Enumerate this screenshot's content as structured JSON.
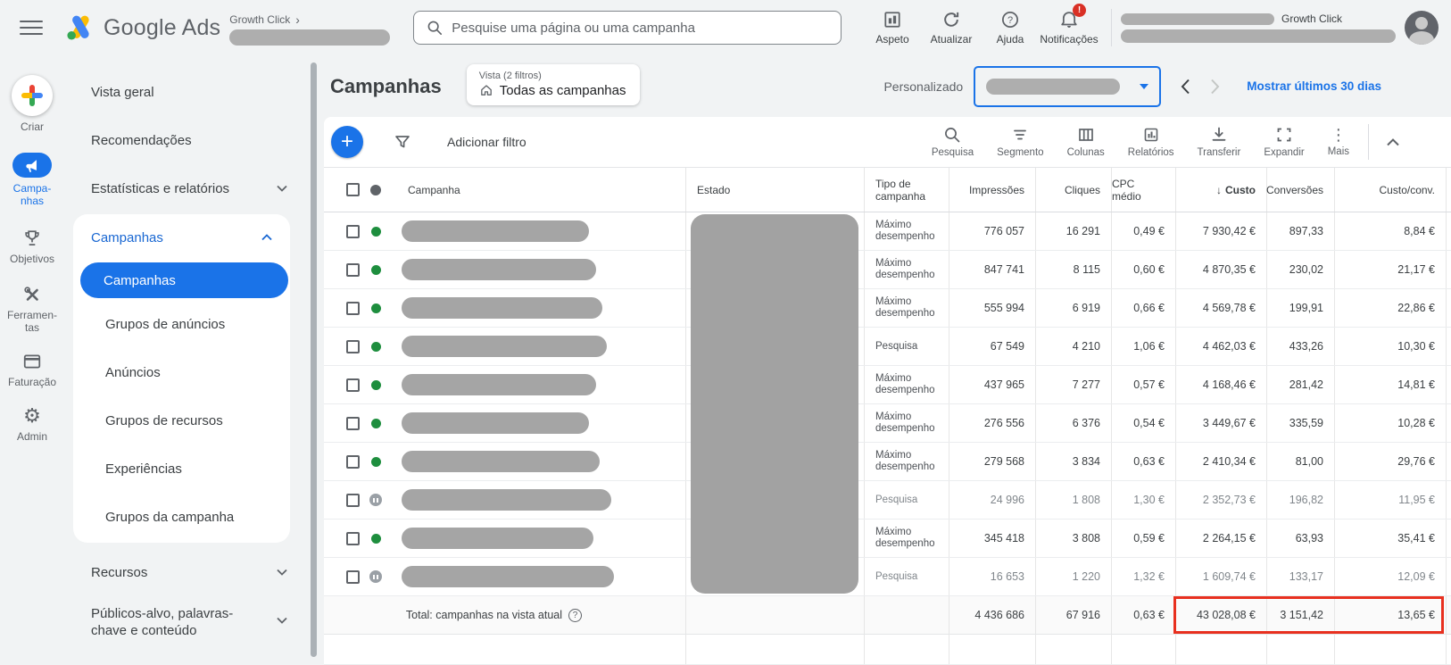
{
  "topbar": {
    "breadcrumb": {
      "account": "Growth Click",
      "chevron": "›"
    },
    "search": {
      "placeholder": "Pesquise uma página ou uma campanha"
    },
    "actions": [
      {
        "label": "Aspeto",
        "icon": "appearance-chart-icon"
      },
      {
        "label": "Atualizar",
        "icon": "refresh-icon"
      },
      {
        "label": "Ajuda",
        "icon": "help-icon"
      },
      {
        "label": "Notificações",
        "icon": "bell-icon",
        "badge": "!"
      }
    ],
    "account": {
      "name": "Growth Click"
    }
  },
  "rail": [
    {
      "label": "Criar",
      "icon": "plus-icon"
    },
    {
      "label": "Campa-nhas",
      "icon": "megaphone-icon"
    },
    {
      "label": "Objetivos",
      "icon": "trophy-icon"
    },
    {
      "label": "Ferramen-tas",
      "icon": "tools-icon"
    },
    {
      "label": "Faturação",
      "icon": "billing-card-icon"
    },
    {
      "label": "Admin",
      "icon": "gear-icon"
    }
  ],
  "sidenav": {
    "top_items": [
      {
        "label": "Vista geral"
      },
      {
        "label": "Recomendações"
      },
      {
        "label": "Estatísticas e relatórios",
        "chevron": "down"
      }
    ],
    "campaigns_group": {
      "label": "Campanhas",
      "chevron": "up",
      "items": [
        {
          "label": "Campanhas",
          "selected": true
        },
        {
          "label": "Grupos de anúncios"
        },
        {
          "label": "Anúncios"
        },
        {
          "label": "Grupos de recursos"
        },
        {
          "label": "Experiências"
        },
        {
          "label": "Grupos da campanha"
        }
      ]
    },
    "bottom_items": [
      {
        "label": "Recursos",
        "chevron": "down"
      },
      {
        "label": "Públicos-alvo, palavras-chave e conteúdo",
        "chevron": "down"
      }
    ]
  },
  "page_header": {
    "title": "Campanhas",
    "view_chip": {
      "caption": "Vista (2 filtros)",
      "value": "Todas as campanhas"
    },
    "date_range": {
      "label": "Personalizado",
      "link": "Mostrar últimos 30 dias"
    }
  },
  "toolbar": {
    "add_filter_label": "Adicionar filtro",
    "buttons": [
      {
        "label": "Pesquisa",
        "icon": "search-icon"
      },
      {
        "label": "Segmento",
        "icon": "segment-icon"
      },
      {
        "label": "Colunas",
        "icon": "columns-icon"
      },
      {
        "label": "Relatórios",
        "icon": "reports-icon"
      },
      {
        "label": "Transferir",
        "icon": "download-icon"
      },
      {
        "label": "Expandir",
        "icon": "expand-icon"
      },
      {
        "label": "Mais",
        "icon": "more-icon"
      }
    ]
  },
  "table": {
    "headers": {
      "campaign": "Campanha",
      "estado": "Estado",
      "tipo": "Tipo de campanha",
      "impressoes": "Impressões",
      "cliques": "Cliques",
      "cpc": "CPC médio",
      "custo_sort": "↓",
      "custo": "Custo",
      "conversoes": "Conversões",
      "custo_conv": "Custo/conv."
    },
    "rows": [
      {
        "status": "enabled",
        "tipo": "Máximo desempenho",
        "impressoes": "776 057",
        "cliques": "16 291",
        "cpc": "0,49 €",
        "custo": "7 930,42 €",
        "conversoes": "897,33",
        "custo_conv": "8,84 €"
      },
      {
        "status": "enabled",
        "tipo": "Máximo desempenho",
        "impressoes": "847 741",
        "cliques": "8 115",
        "cpc": "0,60 €",
        "custo": "4 870,35 €",
        "conversoes": "230,02",
        "custo_conv": "21,17 €"
      },
      {
        "status": "enabled",
        "tipo": "Máximo desempenho",
        "impressoes": "555 994",
        "cliques": "6 919",
        "cpc": "0,66 €",
        "custo": "4 569,78 €",
        "conversoes": "199,91",
        "custo_conv": "22,86 €"
      },
      {
        "status": "enabled",
        "tipo": "Pesquisa",
        "impressoes": "67 549",
        "cliques": "4 210",
        "cpc": "1,06 €",
        "custo": "4 462,03 €",
        "conversoes": "433,26",
        "custo_conv": "10,30 €"
      },
      {
        "status": "enabled",
        "tipo": "Máximo desempenho",
        "impressoes": "437 965",
        "cliques": "7 277",
        "cpc": "0,57 €",
        "custo": "4 168,46 €",
        "conversoes": "281,42",
        "custo_conv": "14,81 €"
      },
      {
        "status": "enabled",
        "tipo": "Máximo desempenho",
        "impressoes": "276 556",
        "cliques": "6 376",
        "cpc": "0,54 €",
        "custo": "3 449,67 €",
        "conversoes": "335,59",
        "custo_conv": "10,28 €"
      },
      {
        "status": "enabled",
        "tipo": "Máximo desempenho",
        "impressoes": "279 568",
        "cliques": "3 834",
        "cpc": "0,63 €",
        "custo": "2 410,34 €",
        "conversoes": "81,00",
        "custo_conv": "29,76 €"
      },
      {
        "status": "paused",
        "tipo": "Pesquisa",
        "impressoes": "24 996",
        "cliques": "1 808",
        "cpc": "1,30 €",
        "custo": "2 352,73 €",
        "conversoes": "196,82",
        "custo_conv": "11,95 €"
      },
      {
        "status": "enabled",
        "tipo": "Máximo desempenho",
        "impressoes": "345 418",
        "cliques": "3 808",
        "cpc": "0,59 €",
        "custo": "2 264,15 €",
        "conversoes": "63,93",
        "custo_conv": "35,41 €"
      },
      {
        "status": "paused",
        "tipo": "Pesquisa",
        "impressoes": "16 653",
        "cliques": "1 220",
        "cpc": "1,32 €",
        "custo": "1 609,74 €",
        "conversoes": "133,17",
        "custo_conv": "12,09 €"
      }
    ],
    "total_row": {
      "label": "Total: campanhas na vista atual",
      "help_icon": "?",
      "impressoes": "4 436 686",
      "cliques": "67 916",
      "cpc": "0,63 €",
      "custo": "43 028,08 €",
      "conversoes": "3 151,42",
      "custo_conv": "13,65 €"
    }
  },
  "colors": {
    "accent_blue": "#1a73e8",
    "nav_group_blue": "#1967d2",
    "enabled_green": "#1e8e3e",
    "paused_gray": "#9aa0a6",
    "red_highlight": "#e8301f",
    "badge_red": "#d93025"
  }
}
